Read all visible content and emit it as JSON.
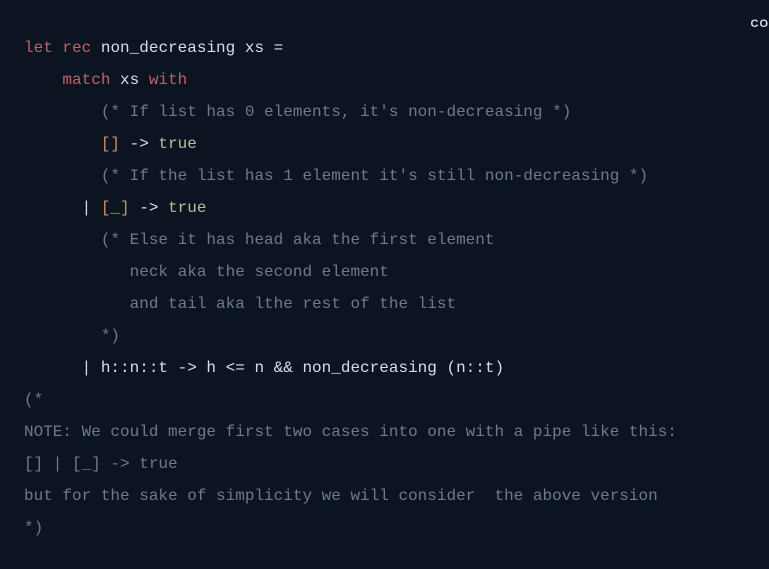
{
  "copyLabel": "CO",
  "code": {
    "line1": {
      "let": "let",
      "rec": "rec",
      "fnName": " non_decreasing xs ="
    },
    "line2": {
      "indent": "    ",
      "match": "match",
      "xs": " xs ",
      "with": "with"
    },
    "line3": {
      "indent": "        ",
      "comment": "(* If list has 0 elements, it's non-decreasing *)"
    },
    "line4": {
      "indent": "        ",
      "brackets": "[]",
      "arrow": " -> ",
      "true": "true"
    },
    "line5": {
      "indent": "        ",
      "comment": "(* If the list has 1 element it's still non-decreasing *)"
    },
    "line6": {
      "indent": "      | ",
      "brackets": "[_]",
      "arrow": " -> ",
      "true": "true"
    },
    "line7": {
      "indent": "        ",
      "comment": "(* Else it has head aka the first element"
    },
    "line8": {
      "indent": "           ",
      "comment": "neck aka the second element"
    },
    "line9": {
      "indent": "           ",
      "comment": "and tail aka lthe rest of the list"
    },
    "line10": {
      "indent": "        ",
      "comment": "*)"
    },
    "line11": {
      "indent": "      ",
      "text": "| h::n::t -> h <= n && non_decreasing (n::t)"
    },
    "line12": {
      "comment": "(*"
    },
    "line13": {
      "comment": "NOTE: We could merge first two cases into one with a pipe like this:"
    },
    "line14": {
      "comment": "[] | [_] -> true"
    },
    "line15": {
      "comment": "but for the sake of simplicity we will consider  the above version"
    },
    "line16": {
      "comment": "*)"
    }
  }
}
